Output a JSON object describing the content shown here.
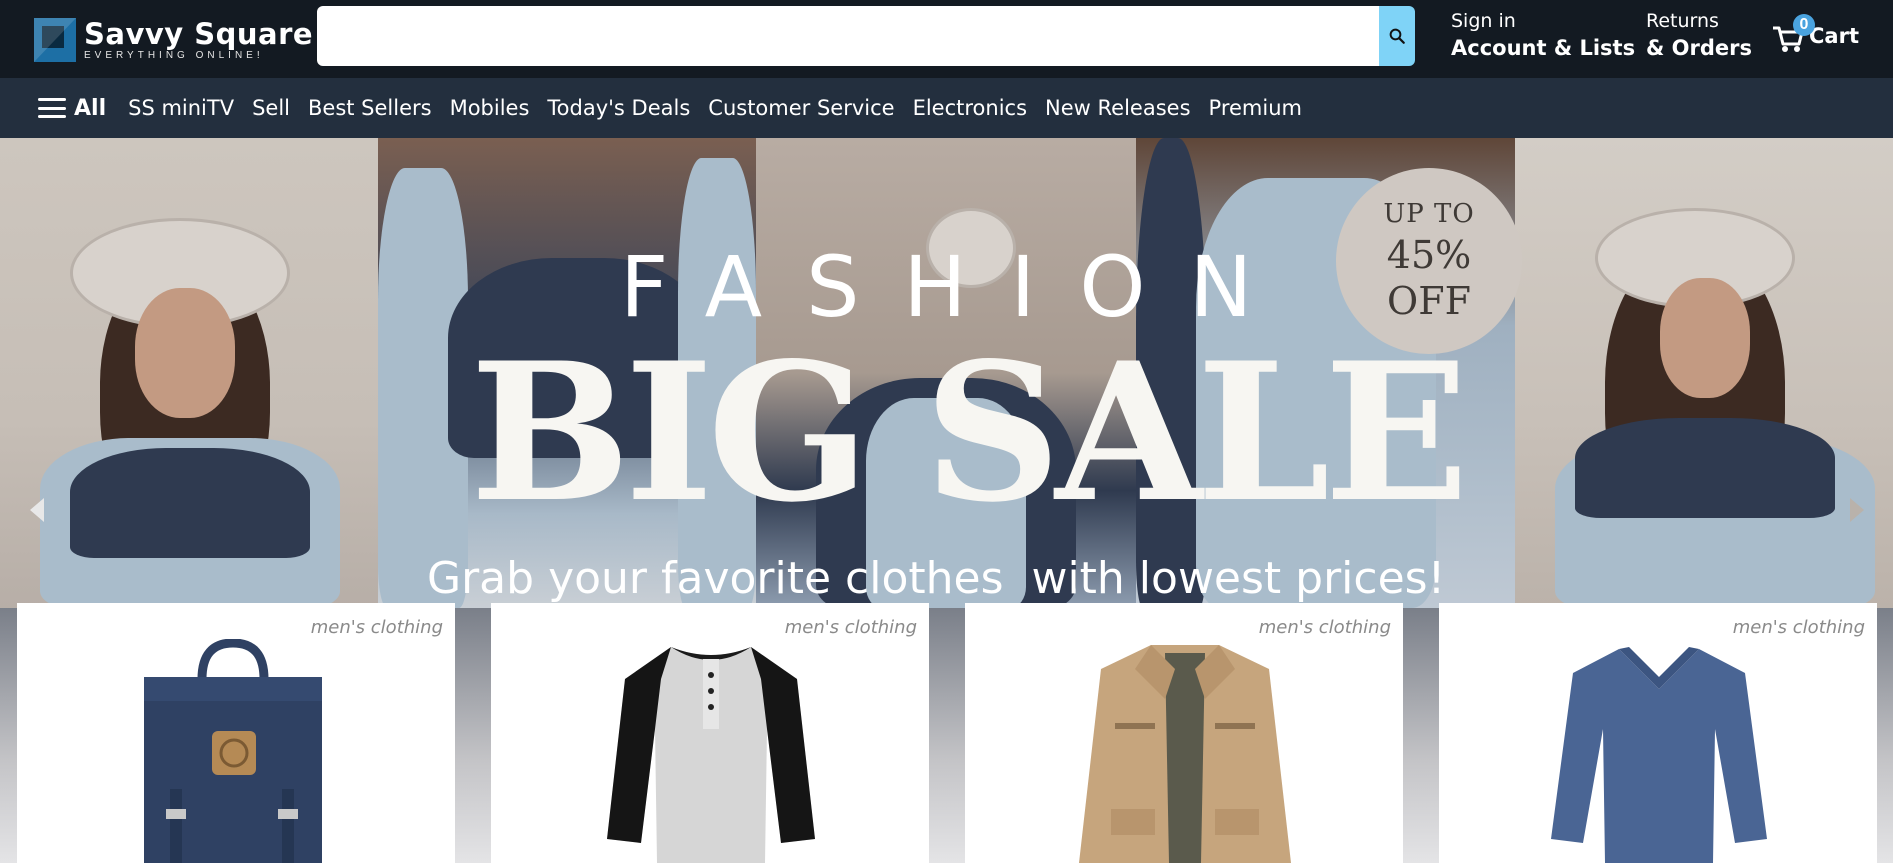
{
  "brand": {
    "name": "Savvy Square",
    "tagline": "EVERYTHING ONLINE!"
  },
  "search": {
    "placeholder": "",
    "value": "",
    "icon": "search-icon"
  },
  "account": {
    "line1": "Sign in",
    "line2": "Account & Lists"
  },
  "returns": {
    "line1": "Returns",
    "line2": "& Orders"
  },
  "cart": {
    "count": "0",
    "label": "Cart",
    "icon": "cart-icon"
  },
  "subnav": {
    "all_label": "All",
    "items": [
      "SS miniTV",
      "Sell",
      "Best Sellers",
      "Mobiles",
      "Today's Deals",
      "Customer Service",
      "Electronics",
      "New Releases",
      "Premium"
    ]
  },
  "hero": {
    "headline_small": "FASHION",
    "headline_big": "BIG SALE",
    "subtitle": "Grab your favorite clothes  with lowest prices!",
    "badge": {
      "line1": "UP TO",
      "line2": "45%",
      "line3": "OFF",
      "color": "#cfc8c2"
    }
  },
  "products": [
    {
      "category": "men's clothing",
      "icon": "backpack-icon"
    },
    {
      "category": "men's clothing",
      "icon": "raglan-tshirt-icon"
    },
    {
      "category": "men's clothing",
      "icon": "jacket-icon"
    },
    {
      "category": "men's clothing",
      "icon": "sweater-icon"
    }
  ],
  "colors": {
    "header_bg": "#131a22",
    "subnav_bg": "#232f3e",
    "search_button": "#7fd3f7",
    "cart_badge": "#4aa3df"
  }
}
